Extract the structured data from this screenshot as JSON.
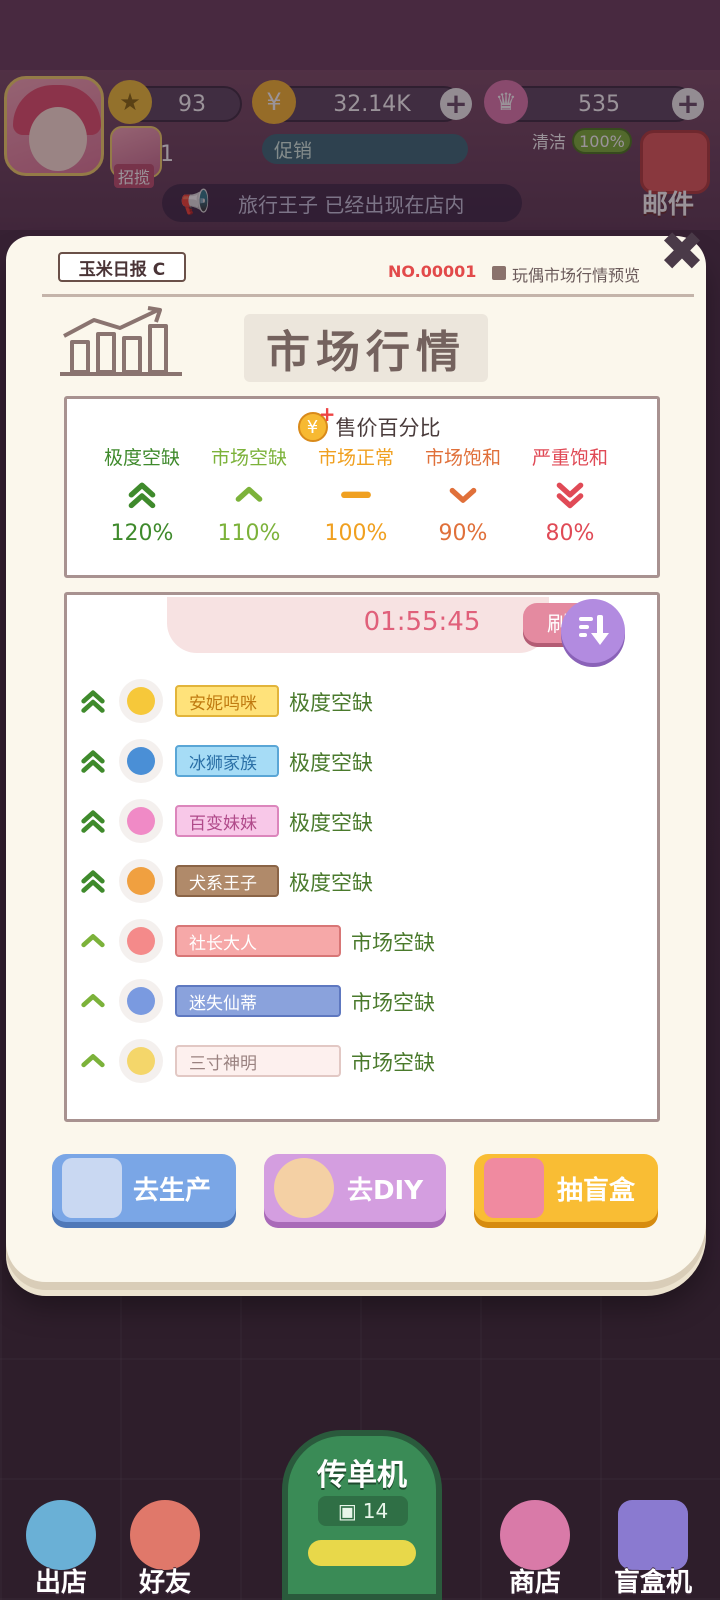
{
  "hud": {
    "stars": "93",
    "coins": "32.14K",
    "gems": "535",
    "sub_count": "1",
    "recruit_label": "招揽",
    "promo_label": "促销",
    "clean_label": "清洁",
    "clean_pct": "100%",
    "mail_label": "邮件",
    "ticker": "旅行王子 已经出现在店内"
  },
  "panel": {
    "masthead": "玉米日报 C",
    "issue_no": "NO.00001",
    "preview_label": "玩偶市场行情预览",
    "headline": "市场行情",
    "close": "✖"
  },
  "legend": {
    "title": "售价百分比",
    "levels": [
      {
        "label": "极度空缺",
        "pct": "120%",
        "color": "#3f8a2c",
        "symbol": "double-up"
      },
      {
        "label": "市场空缺",
        "pct": "110%",
        "color": "#7cb23a",
        "symbol": "up"
      },
      {
        "label": "市场正常",
        "pct": "100%",
        "color": "#f0a020",
        "symbol": "flat"
      },
      {
        "label": "市场饱和",
        "pct": "90%",
        "color": "#e0703a",
        "symbol": "down"
      },
      {
        "label": "严重饱和",
        "pct": "80%",
        "color": "#e04a56",
        "symbol": "double-down"
      }
    ]
  },
  "list": {
    "timer": "01:55:45",
    "refresh_label": "刷新",
    "items": [
      {
        "name": "安妮呜咪",
        "status": "极度空缺",
        "trend": "double-up",
        "tag_bg": "#ffe27a",
        "tag_border": "#e2b43a",
        "tag_color": "#c07a10",
        "icon": "lemon-icon",
        "icon_color": "#f6c83a"
      },
      {
        "name": "冰狮家族",
        "status": "极度空缺",
        "trend": "double-up",
        "tag_bg": "#a6dcf6",
        "tag_border": "#5aa6d6",
        "tag_color": "#2a6fa6",
        "icon": "paw-shield-icon",
        "icon_color": "#4a8fd6"
      },
      {
        "name": "百变妹妹",
        "status": "极度空缺",
        "trend": "double-up",
        "tag_bg": "#f8c8e8",
        "tag_border": "#dc86bc",
        "tag_color": "#b04a8a",
        "icon": "heart-icon",
        "icon_color": "#f08ac6"
      },
      {
        "name": "犬系王子",
        "status": "极度空缺",
        "trend": "double-up",
        "tag_bg": "#b08a6a",
        "tag_border": "#8a6446",
        "tag_color": "#ffffff",
        "icon": "moon-coin-icon",
        "icon_color": "#f0a040"
      },
      {
        "name": "社长大人",
        "status": "市场空缺",
        "trend": "up",
        "tag_bg": "#f6a8a8",
        "tag_border": "#d87676",
        "tag_color": "#ffffff",
        "icon": "perfume-icon",
        "icon_color": "#f48a8a"
      },
      {
        "name": "迷失仙蒂",
        "status": "市场空缺",
        "trend": "up",
        "tag_bg": "#8aa2dc",
        "tag_border": "#5e78c0",
        "tag_color": "#ffffff",
        "icon": "crystal-icon",
        "icon_color": "#7a9ae0"
      },
      {
        "name": "三寸神明",
        "status": "市场空缺",
        "trend": "up",
        "tag_bg": "#fdf0ee",
        "tag_border": "#e2c8c4",
        "tag_color": "#9a8280",
        "icon": "dango-icon",
        "icon_color": "#f4d66a"
      }
    ]
  },
  "actions": {
    "produce": "去生产",
    "diy": "去DIY",
    "blindbox": "抽盲盒"
  },
  "nav": {
    "shop_out": "出店",
    "friends": "好友",
    "flyer": "传单机",
    "flyer_count": "14",
    "store": "商店",
    "blindbox_machine": "盲盒机"
  }
}
